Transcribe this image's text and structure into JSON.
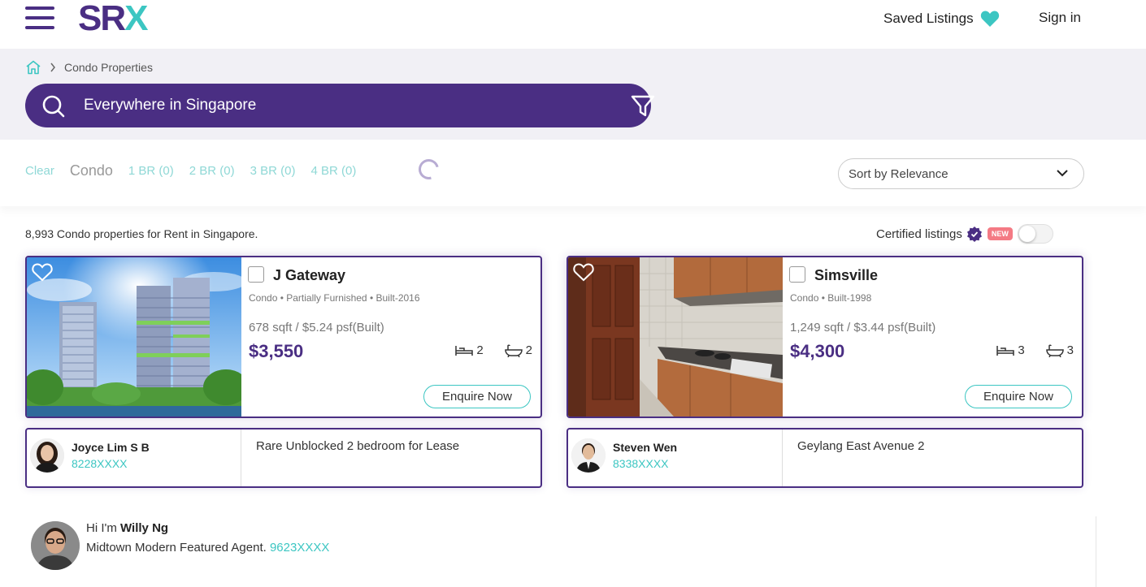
{
  "header": {
    "logo_sr": "SR",
    "logo_x": "X",
    "saved_label": "Saved Listings",
    "signin_label": "Sign in"
  },
  "breadcrumb": {
    "current": "Condo Properties"
  },
  "search": {
    "value": "Everywhere in Singapore"
  },
  "filters": {
    "clear": "Clear",
    "type": "Condo",
    "chips": [
      "1 BR (0)",
      "2 BR (0)",
      "3 BR (0)",
      "4 BR (0)"
    ]
  },
  "sort": {
    "selected": "Sort by Relevance"
  },
  "results": {
    "count_text": "8,993 Condo properties for Rent in Singapore.",
    "certified_label": "Certified listings",
    "new_badge": "NEW"
  },
  "listings": [
    {
      "title": "J Gateway",
      "meta": "Condo • Partially Furnished • Built-2016",
      "size": "678 sqft / $5.24 psf(Built)",
      "price": "$3,550",
      "beds": "2",
      "baths": "2",
      "enquire": "Enquire Now",
      "agent_name": "Joyce Lim S B",
      "agent_phone": "8228XXXX",
      "description": "Rare Unblocked 2 bedroom for Lease"
    },
    {
      "title": "Simsville",
      "meta": "Condo • Built-1998",
      "size": "1,249 sqft / $3.44 psf(Built)",
      "price": "$4,300",
      "beds": "3",
      "baths": "3",
      "enquire": "Enquire Now",
      "agent_name": "Steven Wen",
      "agent_phone": "8338XXXX",
      "description": "Geylang East Avenue 2"
    }
  ],
  "featured_agent": {
    "greeting": "Hi I'm",
    "name": "Willy Ng",
    "tagline": "Midtown Modern Featured Agent.",
    "phone": "9623XXXX"
  },
  "colors": {
    "brand_purple": "#4a2e83",
    "brand_teal": "#3cc6c2",
    "new_badge": "#f47a84"
  }
}
